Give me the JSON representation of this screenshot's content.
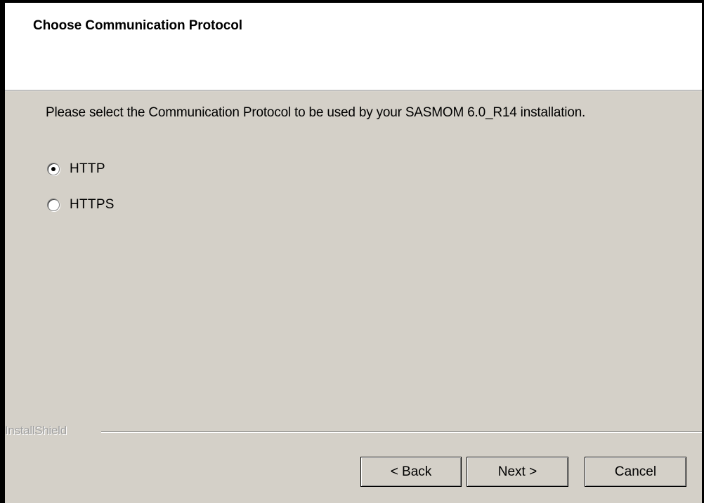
{
  "header": {
    "title": "Choose Communication Protocol"
  },
  "main": {
    "description": "Please select the Communication Protocol to be used by your SASMOM 6.0_R14 installation.",
    "options": [
      {
        "label": "HTTP",
        "selected": true
      },
      {
        "label": "HTTPS",
        "selected": false
      }
    ]
  },
  "footer": {
    "brand": "InstallShield",
    "back_label": "< Back",
    "next_label": "Next >",
    "cancel_label": "Cancel"
  },
  "colors": {
    "dialog_background": "#d4d0c8",
    "header_background": "#ffffff",
    "brand_text": "#a0a0a0"
  },
  "icons": [
    "radio-selected-icon",
    "radio-unselected-icon"
  ]
}
